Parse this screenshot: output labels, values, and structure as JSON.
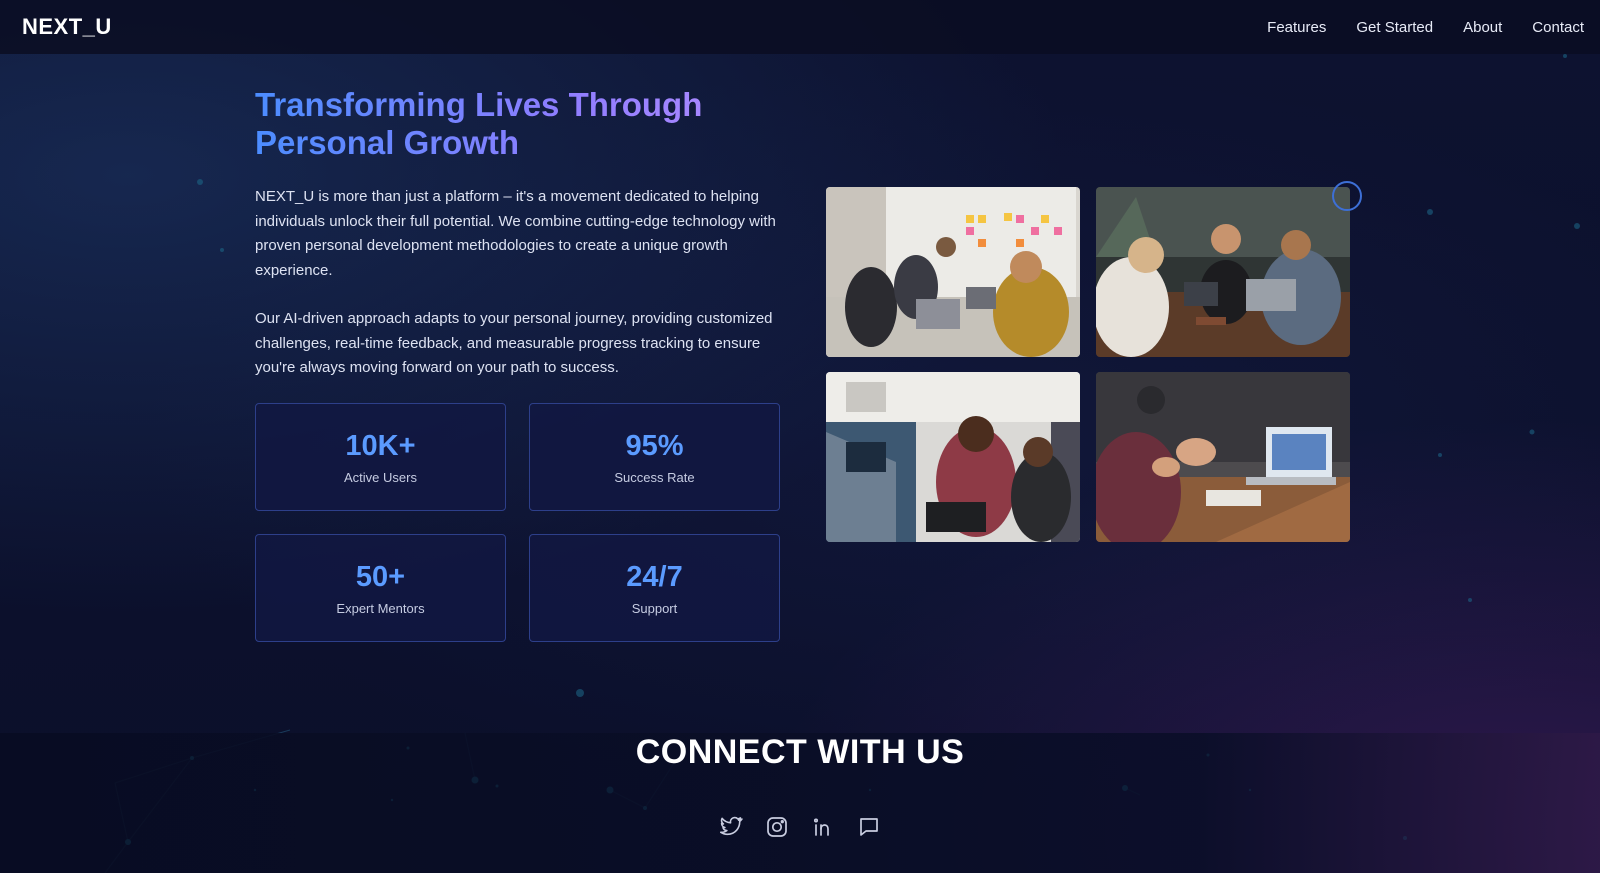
{
  "brand": {
    "logo": "NEXT_U"
  },
  "nav": {
    "items": [
      {
        "label": "Features"
      },
      {
        "label": "Get Started"
      },
      {
        "label": "About"
      },
      {
        "label": "Contact"
      }
    ]
  },
  "hero": {
    "title": "Transforming Lives Through Personal Growth",
    "paragraph_1": "NEXT_U is more than just a platform – it's a movement dedicated to helping individuals unlock their full potential. We combine cutting-edge technology with proven personal development methodologies to create a unique growth experience.",
    "paragraph_2": "Our AI-driven approach adapts to your personal journey, providing customized challenges, real-time feedback, and measurable progress tracking to ensure you're always moving forward on your path to success."
  },
  "stats": [
    {
      "value": "10K+",
      "label": "Active Users"
    },
    {
      "value": "95%",
      "label": "Success Rate"
    },
    {
      "value": "50+",
      "label": "Expert Mentors"
    },
    {
      "value": "24/7",
      "label": "Support"
    }
  ],
  "gallery": {
    "photos": [
      "team-whiteboard-photo",
      "cafe-laptop-photo",
      "coding-team-photo",
      "meeting-laptop-photo"
    ]
  },
  "footer": {
    "title": "CONNECT WITH US",
    "socials": [
      "twitter-icon",
      "instagram-icon",
      "linkedin-icon",
      "chat-icon"
    ]
  },
  "colors": {
    "background": "#0b0f2a",
    "accent_blue": "#5b9bff",
    "title_gradient_start": "#4c8dff",
    "title_gradient_end": "#b28cff",
    "card_border": "#2d3f8a"
  }
}
